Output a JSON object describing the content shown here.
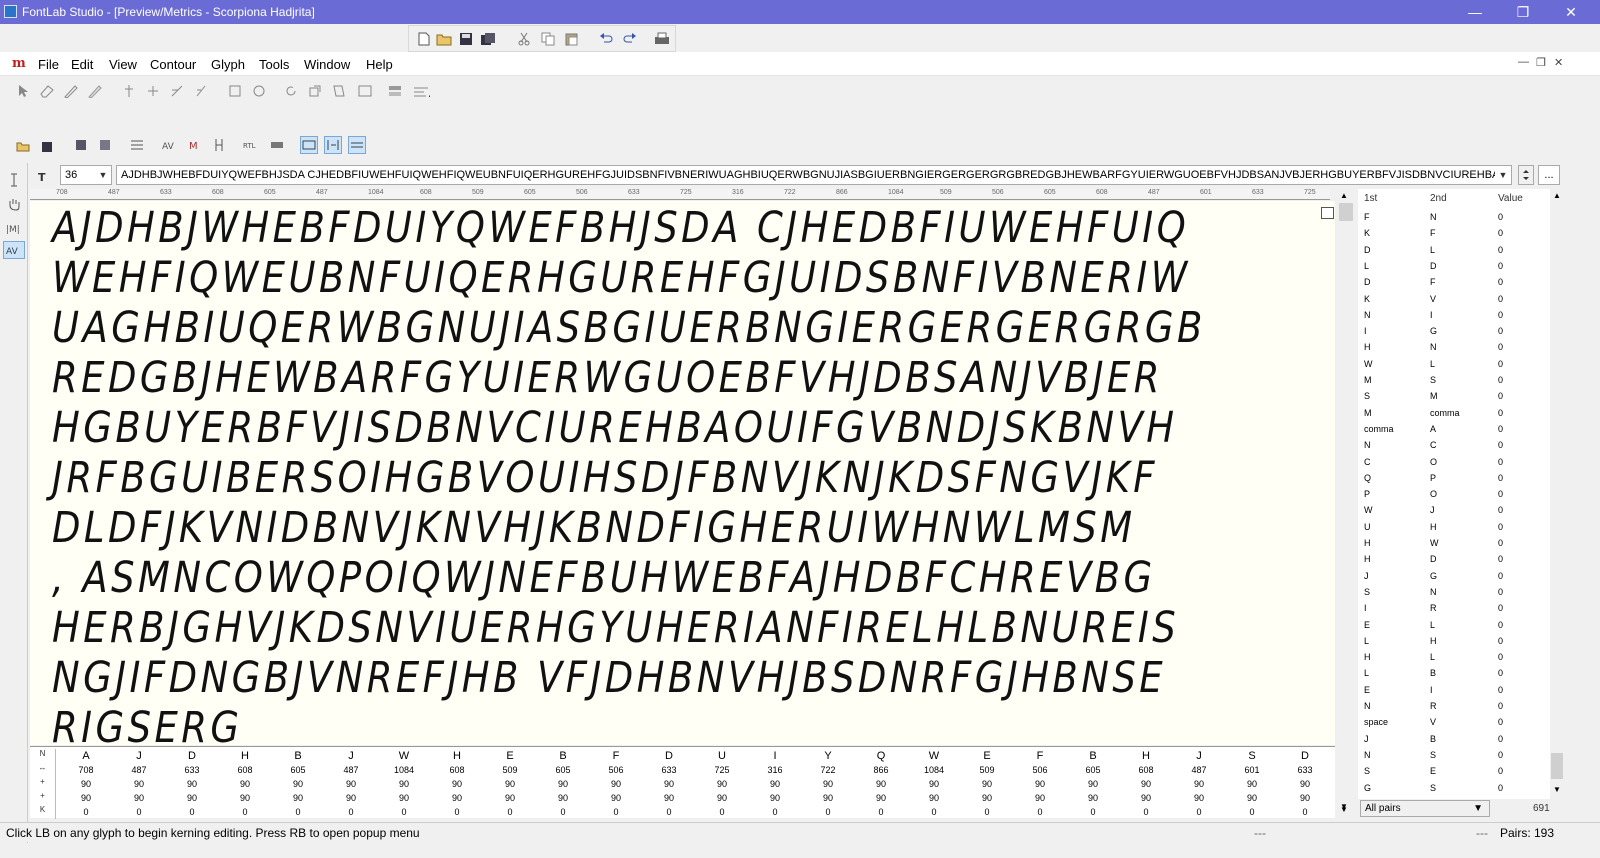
{
  "window": {
    "title": "FontLab Studio - [Preview/Metrics - Scorpiona Hadjrita]"
  },
  "menu": {
    "items": [
      "File",
      "Edit",
      "View",
      "Contour",
      "Glyph",
      "Tools",
      "Window",
      "Help"
    ]
  },
  "preview": {
    "size_value": "36",
    "text_value": "AJDHBJWHEBFDUIYQWEFBHJSDA CJHEDBFIUWEHFUIQWEHFIQWEUBNFUIQERHGUREHFGJUIDSBNFIVBNERIWUAGHBIUQERWBGNUJIASBGIUERBNGIERGERGERGRGBREDGBJHEWBARFGYUIERWGUOEBFVHJDBSANJVBJERHGBUYERBFVJISDBNVCIUREHBAOUIFGVBNDJSKBNVHJRFE",
    "canvas_lines": [
      "AJDHBJWHEBFDUIYQWEFBHJSDA CJHEDBFIUWEHFUIQ",
      "WEHFIQWEUBNFUIQERHGUREHFGJUIDSBNFIVBNERIW",
      "UAGHBIUQERWBGNUJIASBGIUERBNGIERGERGERGRGB",
      "REDGBJHEWBARFGYUIERWGUOEBFVHJDBSANJVBJER",
      "HGBUYERBFVJISDBNVCIUREHBAOUIFGVBNDJSKBNVH",
      "JRFBGUIBERSOIHGBVOUIHSDJFBNVJKNJKDSFNGVJKF",
      "DLDFJKVNIDBNVJKNVHJKBNDFIGHERUIWHNWLMSM",
      ",  ASMNCOWQPOIQWJNEFBUHWEBFAJHDBFCHREVBG",
      "HERBJGHVJKDSNVIUERHGYUHERIANFIRELHLBNUREIS",
      "NGJIFDNGBJVNREFJHB VFJDHBNVHJBSDNRFGJHBNSE",
      "RIGSERG"
    ]
  },
  "ruler": {
    "values": [
      "708",
      "487",
      "633",
      "608",
      "605",
      "487",
      "1084",
      "608",
      "509",
      "605",
      "506",
      "633",
      "725",
      "316",
      "722",
      "866",
      "1084",
      "509",
      "506",
      "605",
      "608",
      "487",
      "601",
      "633",
      "725"
    ]
  },
  "metrics": {
    "row_labels": [
      "N",
      "↔",
      "+",
      "+",
      "K"
    ],
    "glyphs": [
      "A",
      "J",
      "D",
      "H",
      "B",
      "J",
      "W",
      "H",
      "E",
      "B",
      "F",
      "D",
      "U",
      "I",
      "Y",
      "Q",
      "W",
      "E",
      "F",
      "B",
      "H",
      "J",
      "S",
      "D"
    ],
    "widths": [
      "708",
      "487",
      "633",
      "608",
      "605",
      "487",
      "1084",
      "608",
      "509",
      "605",
      "506",
      "633",
      "725",
      "316",
      "722",
      "866",
      "1084",
      "509",
      "506",
      "605",
      "608",
      "487",
      "601",
      "633"
    ],
    "lsb": "90",
    "rsb": "90",
    "kern": "0"
  },
  "kerning": {
    "headers": [
      "1st",
      "2nd",
      "Value"
    ],
    "pairs": [
      [
        "F",
        "N",
        "0"
      ],
      [
        "K",
        "F",
        "0"
      ],
      [
        "D",
        "L",
        "0"
      ],
      [
        "L",
        "D",
        "0"
      ],
      [
        "D",
        "F",
        "0"
      ],
      [
        "K",
        "V",
        "0"
      ],
      [
        "N",
        "I",
        "0"
      ],
      [
        "I",
        "G",
        "0"
      ],
      [
        "H",
        "N",
        "0"
      ],
      [
        "W",
        "L",
        "0"
      ],
      [
        "M",
        "S",
        "0"
      ],
      [
        "S",
        "M",
        "0"
      ],
      [
        "M",
        "comma",
        "0"
      ],
      [
        "comma",
        "A",
        "0"
      ],
      [
        "N",
        "C",
        "0"
      ],
      [
        "C",
        "O",
        "0"
      ],
      [
        "Q",
        "P",
        "0"
      ],
      [
        "P",
        "O",
        "0"
      ],
      [
        "W",
        "J",
        "0"
      ],
      [
        "U",
        "H",
        "0"
      ],
      [
        "H",
        "W",
        "0"
      ],
      [
        "H",
        "D",
        "0"
      ],
      [
        "J",
        "G",
        "0"
      ],
      [
        "S",
        "N",
        "0"
      ],
      [
        "I",
        "R",
        "0"
      ],
      [
        "E",
        "L",
        "0"
      ],
      [
        "L",
        "H",
        "0"
      ],
      [
        "H",
        "L",
        "0"
      ],
      [
        "L",
        "B",
        "0"
      ],
      [
        "E",
        "I",
        "0"
      ],
      [
        "N",
        "R",
        "0"
      ],
      [
        "space",
        "V",
        "0"
      ],
      [
        "J",
        "B",
        "0"
      ],
      [
        "N",
        "S",
        "0"
      ],
      [
        "S",
        "E",
        "0"
      ],
      [
        "G",
        "S",
        "0"
      ]
    ],
    "filter": "All pairs",
    "count": "691"
  },
  "status": {
    "hint": "Click LB on any glyph to begin kerning editing. Press RB to open popup menu",
    "dashes": "---",
    "pairs": "Pairs: 193"
  }
}
